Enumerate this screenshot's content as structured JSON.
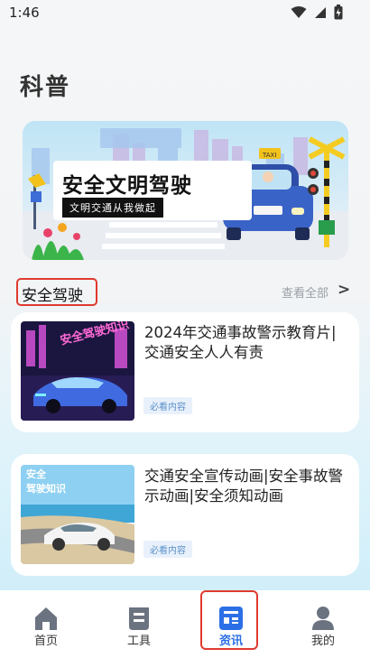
{
  "status_bar": {
    "time": "1:46"
  },
  "page_title": "科普",
  "banner": {
    "title": "安全文明驾驶",
    "subtitle": "文明交通从我做起",
    "taxi_sign": "TAXI"
  },
  "section": {
    "title": "安全驾驶",
    "see_all": "查看全部",
    "see_all_arrow": ">"
  },
  "articles": [
    {
      "title": "2024年交通事故警示教育片| 交通安全人人有责",
      "tag": "必看内容",
      "thumb_text": "安全驾驶知识"
    },
    {
      "title": "交通安全宣传动画|安全事故警示动画|安全须知动画",
      "tag": "必看内容",
      "thumb_text_line1": "安全",
      "thumb_text_line2": "驾驶知识"
    }
  ],
  "bottom_nav": {
    "items": [
      {
        "label": "首页",
        "icon": "home-icon",
        "active": false
      },
      {
        "label": "工具",
        "icon": "tools-icon",
        "active": false
      },
      {
        "label": "资讯",
        "icon": "news-icon",
        "active": true
      },
      {
        "label": "我的",
        "icon": "profile-icon",
        "active": false
      }
    ]
  },
  "colors": {
    "accent_blue": "#2b6fe6",
    "highlight_red": "#e03a2f",
    "tag_text": "#5a8fc8"
  }
}
